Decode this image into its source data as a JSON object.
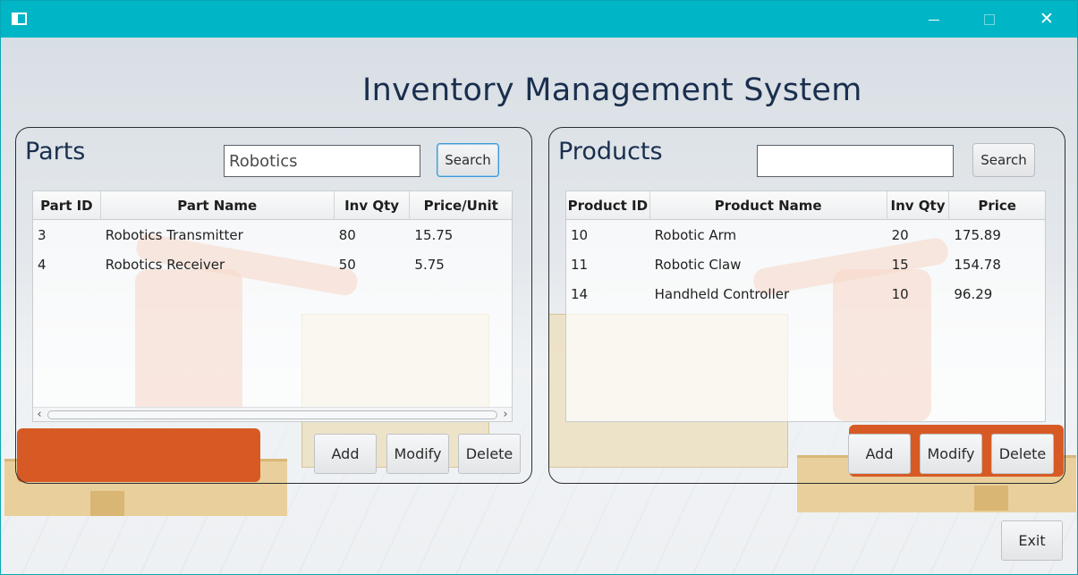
{
  "window": {
    "title_bar_color": "#00b6c6",
    "icons": [
      "app-icon",
      "minimize-icon",
      "maximize-icon",
      "close-icon"
    ],
    "close_glyph": "✕"
  },
  "app_title": "Inventory Management System",
  "parts": {
    "title": "Parts",
    "search_value": "Robotics",
    "search_label": "Search",
    "columns": [
      "Part ID",
      "Part Name",
      "Inv Qty",
      "Price/Unit"
    ],
    "rows": [
      [
        "3",
        "Robotics Transmitter",
        "80",
        "15.75"
      ],
      [
        "4",
        "Robotics Receiver",
        "50",
        "5.75"
      ]
    ],
    "scroll_left": "‹",
    "scroll_right": "›",
    "add_label": "Add",
    "modify_label": "Modify",
    "delete_label": "Delete"
  },
  "products": {
    "title": "Products",
    "search_value": "",
    "search_label": "Search",
    "columns": [
      "Product ID",
      "Product Name",
      "Inv Qty",
      "Price"
    ],
    "rows": [
      [
        "10",
        "Robotic Arm",
        "20",
        "175.89"
      ],
      [
        "11",
        "Robotic Claw",
        "15",
        "154.78"
      ],
      [
        "14",
        "Handheld Controller",
        "10",
        "96.29"
      ]
    ],
    "add_label": "Add",
    "modify_label": "Modify",
    "delete_label": "Delete"
  },
  "exit_label": "Exit"
}
